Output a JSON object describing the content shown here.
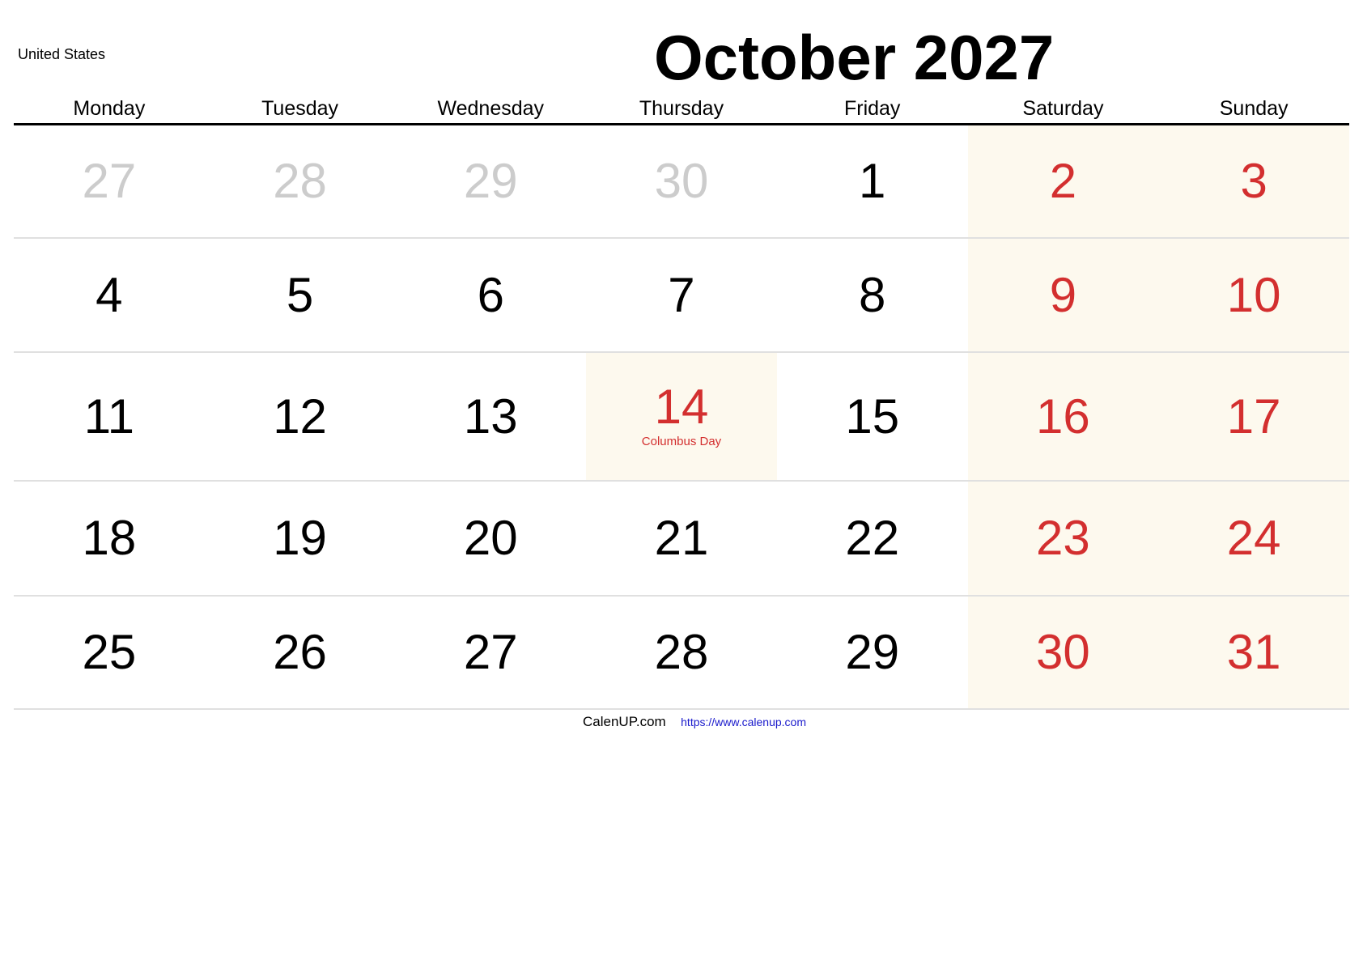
{
  "header": {
    "region": "United States",
    "title": "October 2027"
  },
  "colors": {
    "weekend_text": "#d32f2f",
    "weekend_bg": "#fdf9ee",
    "muted_text": "#cccccc",
    "link": "#1a1acc"
  },
  "weekdays": [
    "Monday",
    "Tuesday",
    "Wednesday",
    "Thursday",
    "Friday",
    "Saturday",
    "Sunday"
  ],
  "weeks": [
    [
      {
        "day": "27",
        "muted": true
      },
      {
        "day": "28",
        "muted": true
      },
      {
        "day": "29",
        "muted": true
      },
      {
        "day": "30",
        "muted": true
      },
      {
        "day": "1"
      },
      {
        "day": "2",
        "weekend": true
      },
      {
        "day": "3",
        "weekend": true
      }
    ],
    [
      {
        "day": "4"
      },
      {
        "day": "5"
      },
      {
        "day": "6"
      },
      {
        "day": "7"
      },
      {
        "day": "8"
      },
      {
        "day": "9",
        "weekend": true
      },
      {
        "day": "10",
        "weekend": true
      }
    ],
    [
      {
        "day": "11"
      },
      {
        "day": "12"
      },
      {
        "day": "13"
      },
      {
        "day": "14",
        "holiday": "Columbus Day"
      },
      {
        "day": "15"
      },
      {
        "day": "16",
        "weekend": true
      },
      {
        "day": "17",
        "weekend": true
      }
    ],
    [
      {
        "day": "18"
      },
      {
        "day": "19"
      },
      {
        "day": "20"
      },
      {
        "day": "21"
      },
      {
        "day": "22"
      },
      {
        "day": "23",
        "weekend": true
      },
      {
        "day": "24",
        "weekend": true
      }
    ],
    [
      {
        "day": "25"
      },
      {
        "day": "26"
      },
      {
        "day": "27"
      },
      {
        "day": "28"
      },
      {
        "day": "29"
      },
      {
        "day": "30",
        "weekend": true
      },
      {
        "day": "31",
        "weekend": true
      }
    ]
  ],
  "footer": {
    "brand": "CalenUP.com",
    "url": "https://www.calenup.com"
  }
}
